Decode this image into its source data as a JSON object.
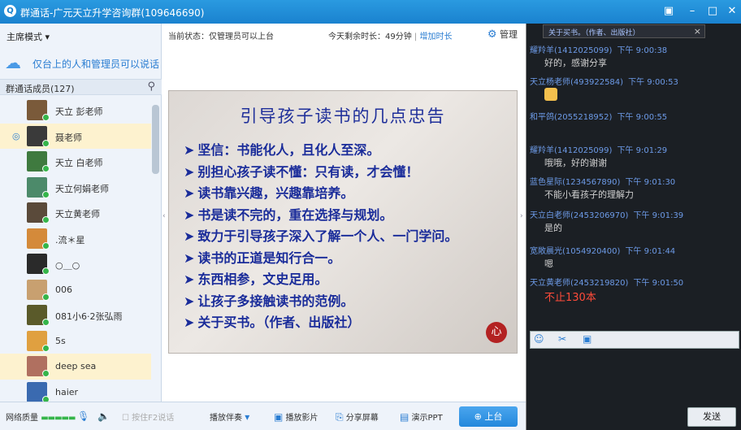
{
  "window": {
    "title": "群通话-广元天立升学咨询群(109646690)",
    "logo": "Q"
  },
  "left": {
    "mode_label": "主席模式",
    "notice": "仅台上的人和管理员可以说话",
    "members_header": "群通话成员(127)",
    "members": [
      {
        "name": "天立 彭老师",
        "color": "#7a5a3a",
        "selected": false,
        "pin": false
      },
      {
        "name": "聂老师",
        "color": "#3a3a3a",
        "selected": true,
        "pin": true
      },
      {
        "name": "天立 白老师",
        "color": "#3f7a3f",
        "selected": false,
        "pin": false
      },
      {
        "name": "天立何娟老师",
        "color": "#4c8a6a",
        "selected": false,
        "pin": false
      },
      {
        "name": "天立黄老师",
        "color": "#5a4a3a",
        "selected": false,
        "pin": false
      },
      {
        "name": ".流＊星",
        "color": "#d48a3a",
        "selected": false,
        "pin": false
      },
      {
        "name": "○＿○",
        "color": "#2a2a2a",
        "selected": false,
        "pin": false
      },
      {
        "name": "006",
        "color": "#c8a070",
        "selected": false,
        "pin": false
      },
      {
        "name": "081小6·2张弘雨",
        "color": "#5a5a2a",
        "selected": false,
        "pin": false
      },
      {
        "name": "5s",
        "color": "#e0a040",
        "selected": false,
        "pin": false
      },
      {
        "name": "deep  sea",
        "color": "#b07060",
        "selected": true,
        "pin": false
      },
      {
        "name": "haier",
        "color": "#3a6ab0",
        "selected": false,
        "pin": false
      }
    ]
  },
  "center": {
    "status": "当前状态：仅管理员可以上台",
    "remain_label": "今天剩余时长：49分钟",
    "remain_sep": "|",
    "add_time": "增加时长",
    "manage": "管理",
    "slide": {
      "title": "引导孩子读书的几点忠告",
      "points": [
        "坚信：书能化人，且化人至深。",
        "别担心孩子读不懂：只有读，才会懂！",
        "读书靠兴趣，兴趣靠培养。",
        "书是读不完的，重在选择与规划。",
        "致力于引导孩子深入了解一个人、一门学问。",
        "读书的正道是知行合一。",
        "东西相参，文史足用。",
        "让孩子多接触读书的范例。",
        "关于买书。（作者、出版社）"
      ],
      "seal": "心"
    }
  },
  "bottom": {
    "net_quality": "网络质量",
    "f2_talk": "按住F2说话",
    "accompany": "播放伴奏",
    "play_movie": "播放影片",
    "share_screen": "分享屏幕",
    "present_ppt": "演示PPT",
    "on_stage": "上台"
  },
  "right": {
    "pinned": "关于买书。（作者、出版社）",
    "messages": [
      {
        "who": "耀羚羊(1412025099)",
        "time": "下午 9:00:38",
        "body": "好的，感谢分享",
        "big": false,
        "emoji": false
      },
      {
        "who": "天立杨老师(493922584)",
        "time": "下午 9:00:53",
        "body": "",
        "big": false,
        "emoji": true
      },
      {
        "who": "和平鸽(2055218952)",
        "time": "下午 9:00:55",
        "body": "",
        "big": false,
        "emoji": false
      },
      {
        "who": "耀羚羊(1412025099)",
        "time": "下午 9:01:29",
        "body": "哦哦，好的谢谢",
        "big": false,
        "emoji": false
      },
      {
        "who": "蓝色星际(1234567890)",
        "time": "下午 9:01:30",
        "body": "不能小看孩子的理解力",
        "big": false,
        "emoji": false
      },
      {
        "who": "天立白老师(2453206970)",
        "time": "下午 9:01:39",
        "body": "是的",
        "big": false,
        "emoji": false
      },
      {
        "who": "宽敞晨光(1054920400)",
        "time": "下午 9:01:44",
        "body": "嗯",
        "big": false,
        "emoji": false
      },
      {
        "who": "天立黄老师(2453219820)",
        "time": "下午 9:01:50",
        "body": "不止130本",
        "big": true,
        "emoji": false
      }
    ],
    "send": "发送"
  }
}
